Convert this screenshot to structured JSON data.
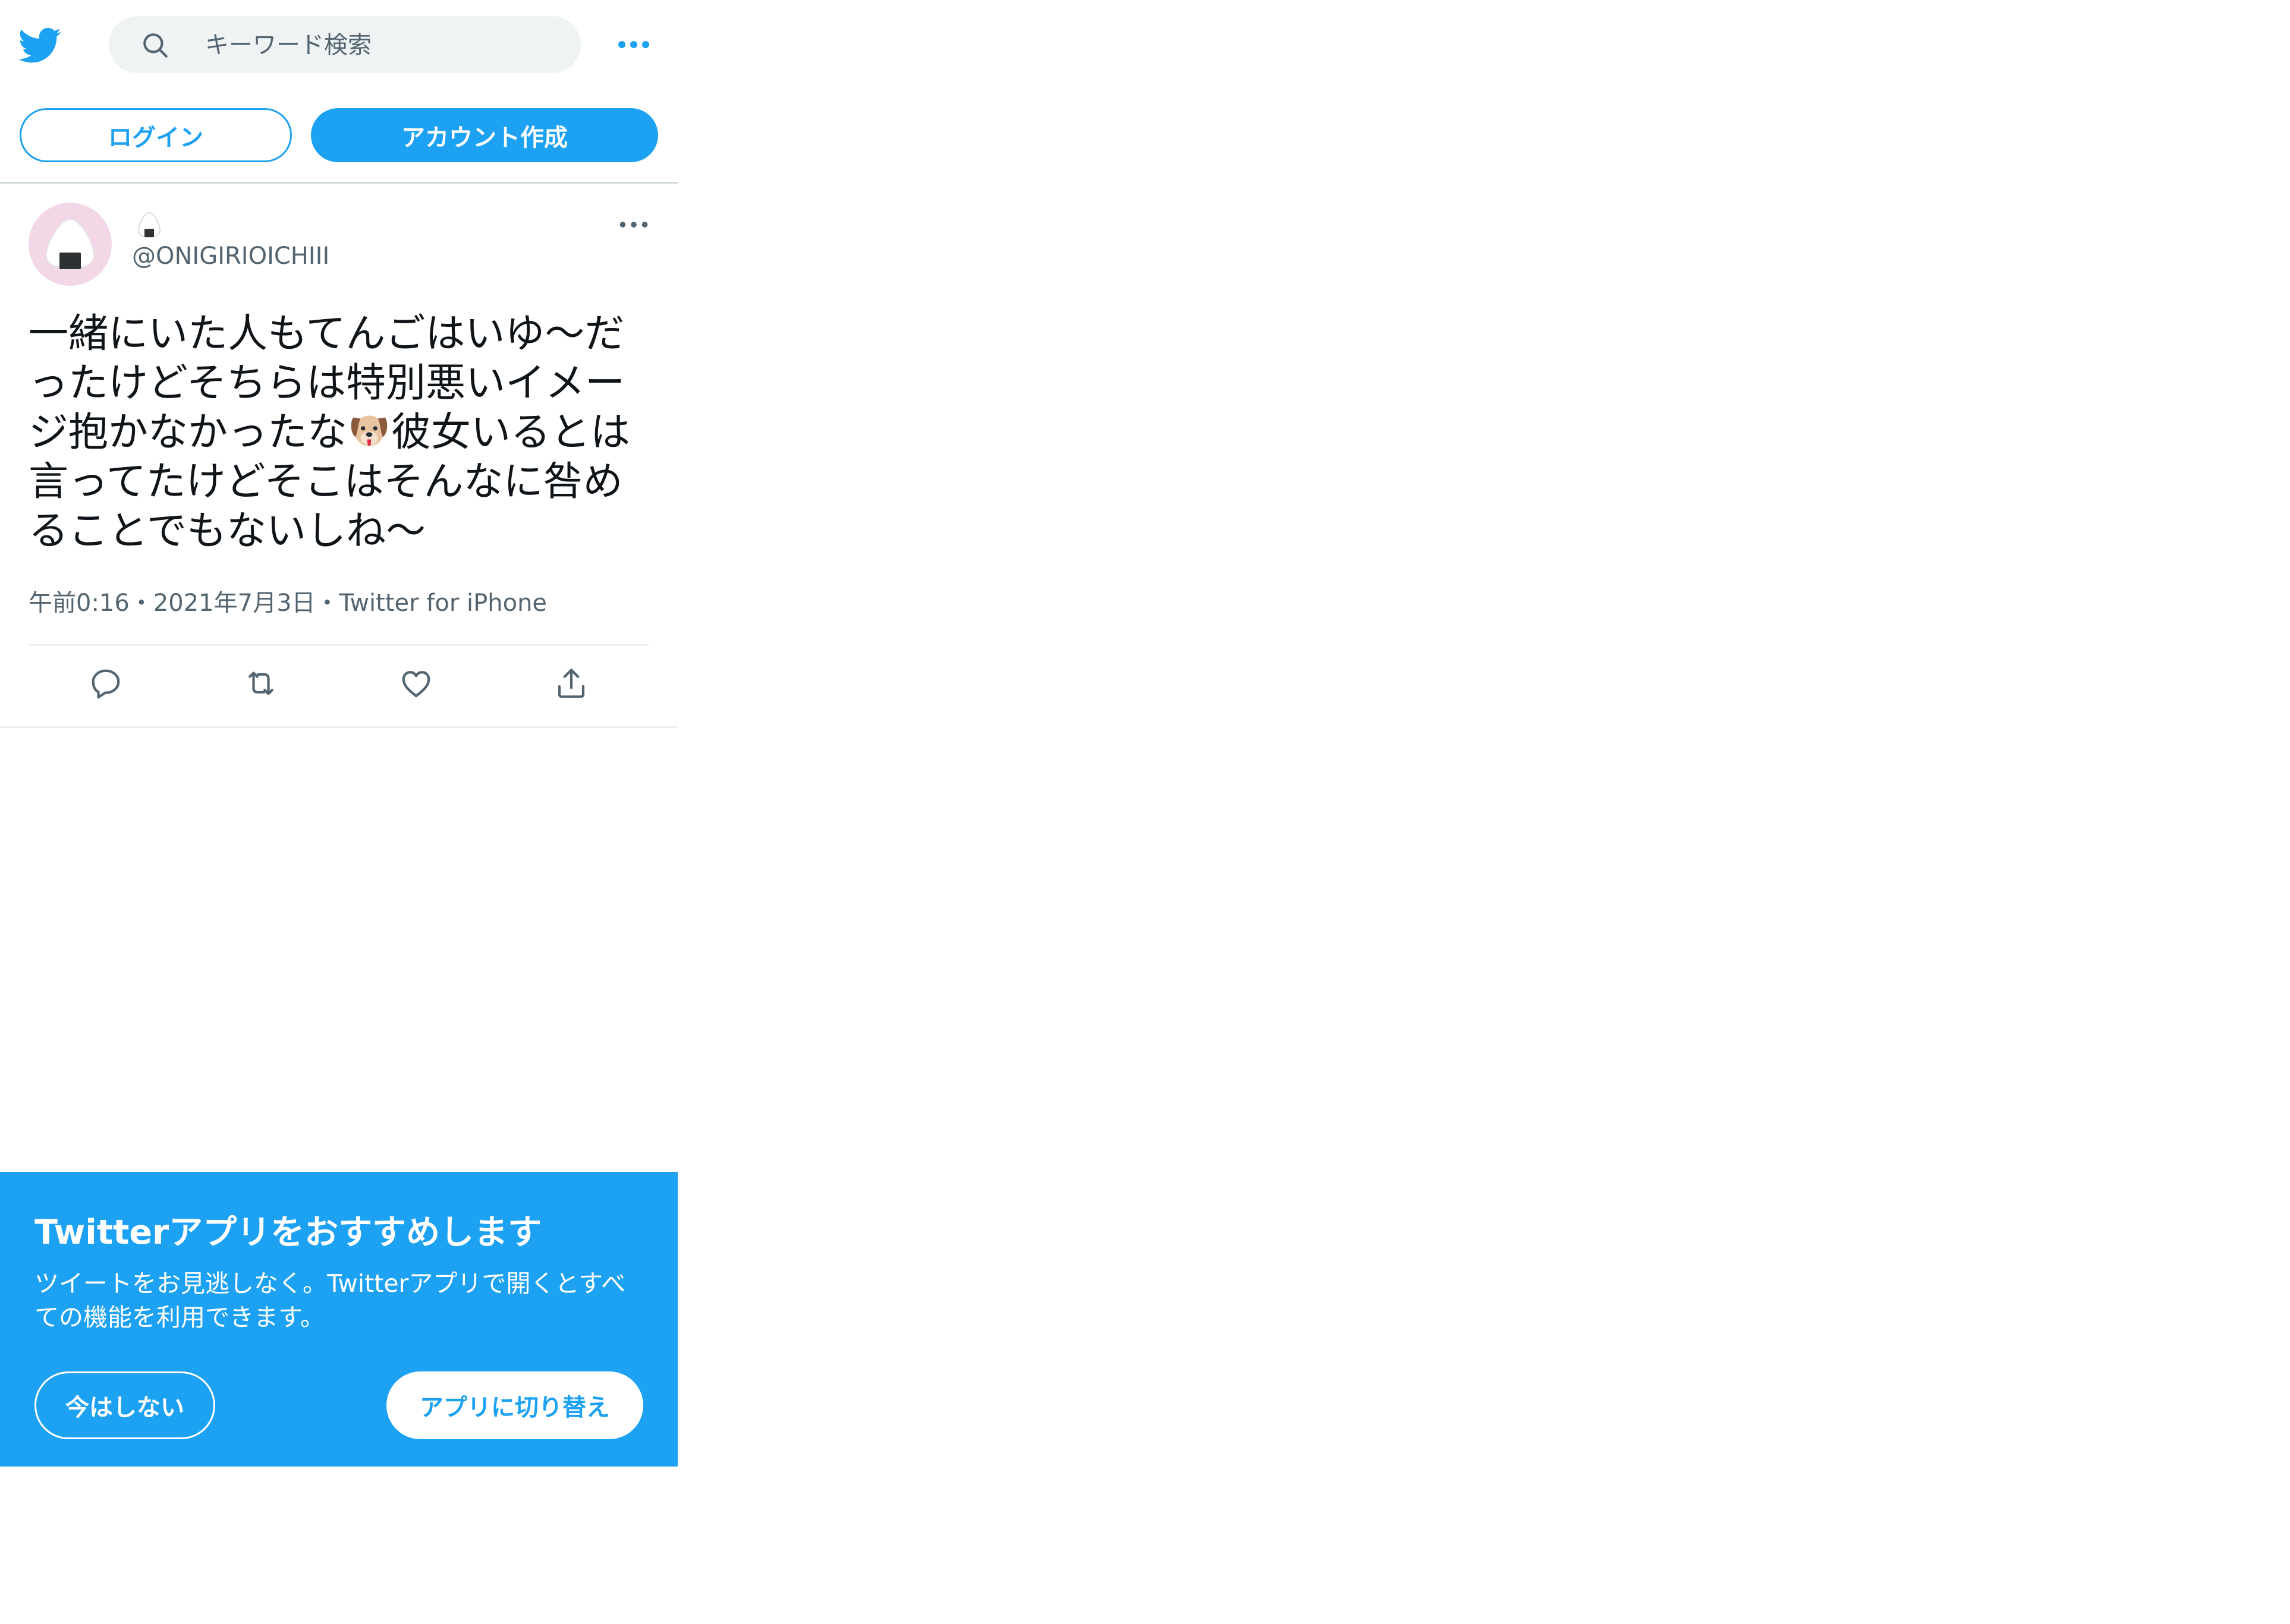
{
  "header": {
    "search_placeholder": "キーワード検索",
    "login_label": "ログイン",
    "signup_label": "アカウント作成"
  },
  "tweet": {
    "display_name_icon": "onigiri-emoji",
    "handle": "@ONIGIRIOICHIII",
    "text_part1": "一緒にいた人もてんごはいゆ〜だったけどそちらは特別悪いイメージ抱かなかったな",
    "text_emoji": "dog-face-emoji",
    "text_part2": "彼女いるとは言ってたけどそこはそんなに咎めることでもないしね〜",
    "time": "午前0:16",
    "separator": "・",
    "date": "2021年7月3日",
    "source": "Twitter for iPhone"
  },
  "banner": {
    "title": "Twitterアプリをおすすめします",
    "body": "ツイートをお見逃しなく。Twitterアプリで開くとすべての機能を利用できます。",
    "later_label": "今はしない",
    "switch_label": "アプリに切り替え"
  },
  "colors": {
    "brand": "#1da1f2",
    "text": "#0f1419",
    "secondary_text": "#536471",
    "avatar_bg": "#f2d7e6"
  }
}
